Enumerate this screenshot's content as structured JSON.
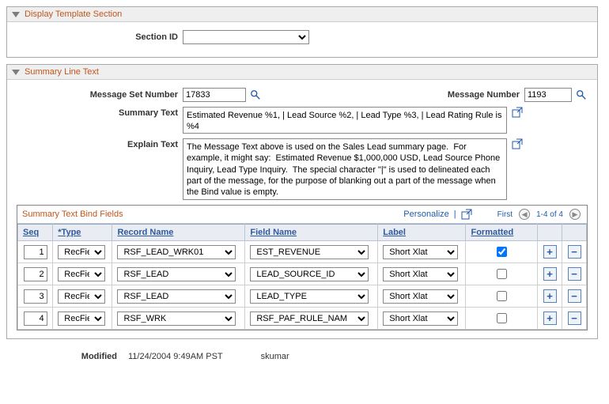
{
  "sections": {
    "display_template_header": "Display Template Section",
    "section_id_label": "Section ID",
    "section_id_value": "",
    "summary_line_header": "Summary Line Text"
  },
  "msg": {
    "set_label": "Message Set Number",
    "set_value": "17833",
    "num_label": "Message Number",
    "num_value": "1193"
  },
  "summary_text": {
    "label": "Summary Text",
    "value": "Estimated Revenue %1, | Lead Source %2, | Lead Type %3, | Lead Rating Rule is %4"
  },
  "explain_text": {
    "label": "Explain Text",
    "value": "The Message Text above is used on the Sales Lead summary page.  For example, it might say:  Estimated Revenue $1,000,000 USD, Lead Source Phone Inquiry, Lead Type Inquiry.  The special character \"|\" is used to delineated each part of the message, for the purpose of blanking out a part of the message when the Bind value is empty."
  },
  "grid": {
    "title": "Summary Text Bind Fields",
    "personalize_label": "Personalize",
    "nav_first_label": "First",
    "nav_range": "1-4 of 4",
    "columns": {
      "seq": "Seq",
      "type": "*Type",
      "record": "Record Name",
      "field": "Field Name",
      "label": "Label",
      "formatted": "Formatted"
    },
    "rows": [
      {
        "seq": "1",
        "type": "RecFie",
        "record": "RSF_LEAD_WRK01",
        "field": "EST_REVENUE",
        "label_opt": "Short Xlat",
        "formatted": true
      },
      {
        "seq": "2",
        "type": "RecFie",
        "record": "RSF_LEAD",
        "field": "LEAD_SOURCE_ID",
        "label_opt": "Short Xlat",
        "formatted": false
      },
      {
        "seq": "3",
        "type": "RecFie",
        "record": "RSF_LEAD",
        "field": "LEAD_TYPE",
        "label_opt": "Short Xlat",
        "formatted": false
      },
      {
        "seq": "4",
        "type": "RecFie",
        "record": "RSF_WRK",
        "field": "RSF_PAF_RULE_NAM",
        "label_opt": "Short Xlat",
        "formatted": false
      }
    ]
  },
  "footer": {
    "modified_label": "Modified",
    "modified_date": "11/24/2004  9:49AM PST",
    "modified_by": "skumar"
  }
}
